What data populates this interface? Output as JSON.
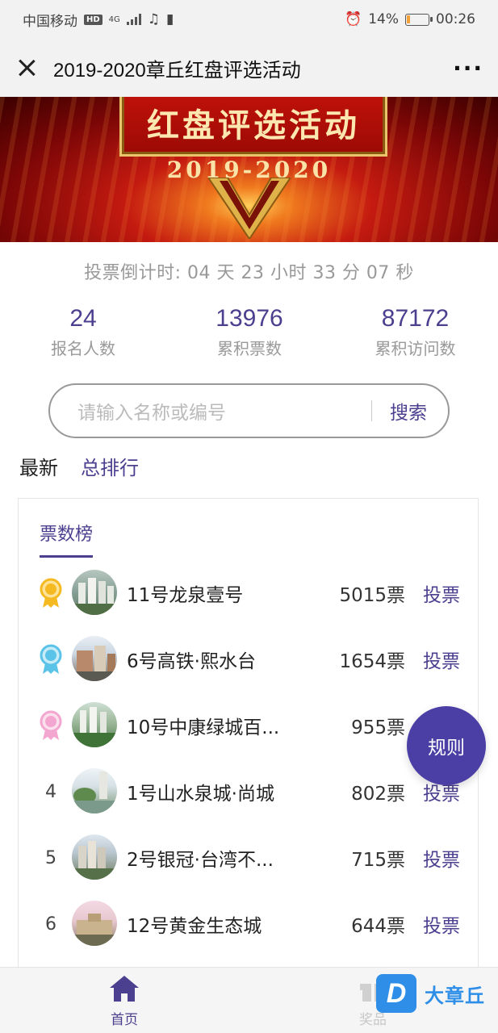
{
  "status_bar": {
    "carrier": "中国移动",
    "hd": "HD",
    "network": "4G",
    "battery": "14%",
    "time": "00:26"
  },
  "nav": {
    "title": "2019-2020章丘红盘评选活动"
  },
  "banner": {
    "headline": "红盘评选活动",
    "year": "2019-2020"
  },
  "countdown": {
    "text": "投票倒计时: 04 天 23 小时 33 分 07 秒"
  },
  "stats": [
    {
      "value": "24",
      "label": "报名人数"
    },
    {
      "value": "13976",
      "label": "累积票数"
    },
    {
      "value": "87172",
      "label": "累积访问数"
    }
  ],
  "search": {
    "placeholder": "请输入名称或编号",
    "button": "搜索"
  },
  "tabs": {
    "latest": "最新",
    "ranking": "总排行"
  },
  "card": {
    "title": "票数榜"
  },
  "entries": [
    {
      "rank": "",
      "medal": "gold",
      "name": "11号龙泉壹号",
      "votes": "5015票",
      "action": "投票"
    },
    {
      "rank": "",
      "medal": "blue",
      "name": "6号高铁·熙水台",
      "votes": "1654票",
      "action": "投票"
    },
    {
      "rank": "",
      "medal": "pink",
      "name": "10号中康绿城百...",
      "votes": "955票",
      "action": ""
    },
    {
      "rank": "4",
      "medal": "",
      "name": "1号山水泉城·尚城",
      "votes": "802票",
      "action": "投票"
    },
    {
      "rank": "5",
      "medal": "",
      "name": "2号银冠·台湾不...",
      "votes": "715票",
      "action": "投票"
    },
    {
      "rank": "6",
      "medal": "",
      "name": "12号黄金生态城",
      "votes": "644票",
      "action": "投票"
    }
  ],
  "rules_button": "规则",
  "bottom_nav": {
    "home": "首页",
    "prize": "奖品"
  },
  "watermark": {
    "logo": "D",
    "text": "大章丘"
  },
  "colors": {
    "accent": "#4b3f8f",
    "banner_red": "#c41a10",
    "gold": "#f5b921",
    "blue_medal": "#5bc3e8",
    "pink_medal": "#f3a6cf"
  }
}
